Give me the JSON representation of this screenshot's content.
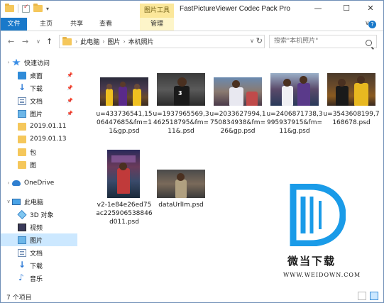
{
  "window": {
    "title": "FastPictureViewer Codec Pack Pro",
    "tool_tab": "图片工具",
    "controls": {
      "minimize": "—",
      "maximize": "☐",
      "close": "✕"
    }
  },
  "ribbon": {
    "tabs": [
      {
        "label": "文件"
      },
      {
        "label": "主页"
      },
      {
        "label": "共享"
      },
      {
        "label": "查看"
      },
      {
        "label": "管理"
      }
    ],
    "collapse": "∨",
    "help": "?"
  },
  "address": {
    "back": "←",
    "forward": "→",
    "recent": "∨",
    "up": "↑",
    "crumbs": [
      "此电脑",
      "图片",
      "本机照片"
    ],
    "crumb_sep": "›",
    "dropdown": "∨",
    "refresh": "↻"
  },
  "search": {
    "placeholder": "搜索\"本机照片\""
  },
  "navpane": {
    "items": [
      {
        "label": "快速访问",
        "icon": "star-icon"
      },
      {
        "label": "桌面",
        "icon": "desktop-icon",
        "pinned": true
      },
      {
        "label": "下载",
        "icon": "download-icon",
        "pinned": true
      },
      {
        "label": "文档",
        "icon": "document-icon",
        "pinned": true
      },
      {
        "label": "图片",
        "icon": "pictures-icon",
        "pinned": true
      },
      {
        "label": "2019.01.11",
        "icon": "folder-icon"
      },
      {
        "label": "2019.01.13",
        "icon": "folder-icon"
      },
      {
        "label": "包",
        "icon": "folder-icon"
      },
      {
        "label": "图",
        "icon": "folder-icon"
      },
      {
        "label": "OneDrive",
        "icon": "onedrive-icon"
      },
      {
        "label": "此电脑",
        "icon": "computer-icon"
      },
      {
        "label": "3D 对象",
        "icon": "3d-objects-icon"
      },
      {
        "label": "视频",
        "icon": "video-icon"
      },
      {
        "label": "图片",
        "icon": "pictures-icon",
        "selected": true
      },
      {
        "label": "文档",
        "icon": "document-icon"
      },
      {
        "label": "下载",
        "icon": "download-icon"
      },
      {
        "label": "音乐",
        "icon": "music-icon"
      }
    ]
  },
  "files": [
    {
      "name": "u=433736541,1506447685&fm=11&gp.psd"
    },
    {
      "name": "u=1937965569,3462518795&fm=11&.psd"
    },
    {
      "name": "u=2033627994,1750834938&fm=26&gp.psd"
    },
    {
      "name": "u=2406871738,3995937915&fm=11&g.psd"
    },
    {
      "name": "u=3543608199,7168678.psd"
    },
    {
      "name": "v2-1e84e26ed75ac225906538846d011.psd"
    },
    {
      "name": "dataUrlIm.psd"
    }
  ],
  "status": {
    "count": "7 个项目"
  },
  "watermark": {
    "cn": "微当下载",
    "en": "WWW.WEIDOWN.COM"
  },
  "colors": {
    "accent": "#1979ca",
    "selected": "#cce8ff",
    "tool_tab": "#fbe79a"
  }
}
